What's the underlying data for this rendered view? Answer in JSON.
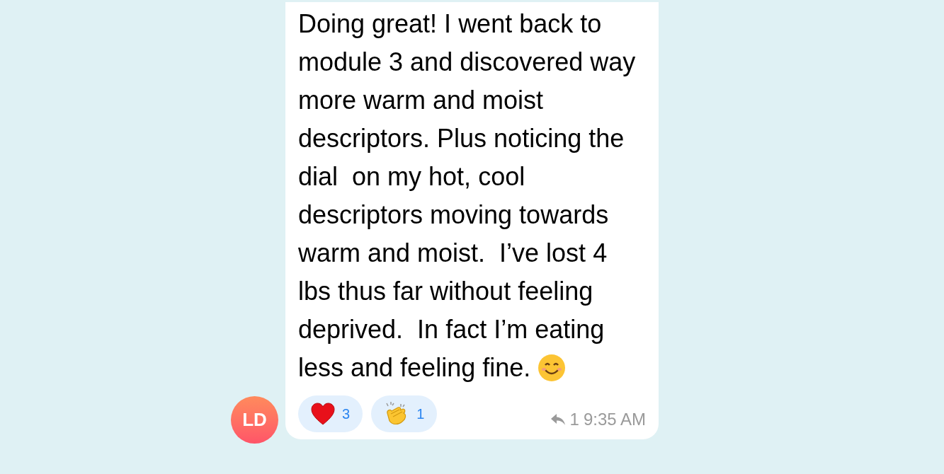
{
  "message": {
    "text": "Doing great! I went back to module 3 and discovered way more warm and moist descriptors. Plus noticing the dial  on my hot, cool descriptors moving towards warm and moist.  I’ve lost 4 lbs thus far without feeling deprived.  In fact I’m eating less and feeling fine.",
    "ends_with_smiley": true,
    "reactions": [
      {
        "kind": "heart",
        "count": "3"
      },
      {
        "kind": "clap",
        "count": "1"
      }
    ],
    "replies": "1",
    "time": "9:35 AM",
    "avatar": {
      "initials": "LD"
    }
  }
}
